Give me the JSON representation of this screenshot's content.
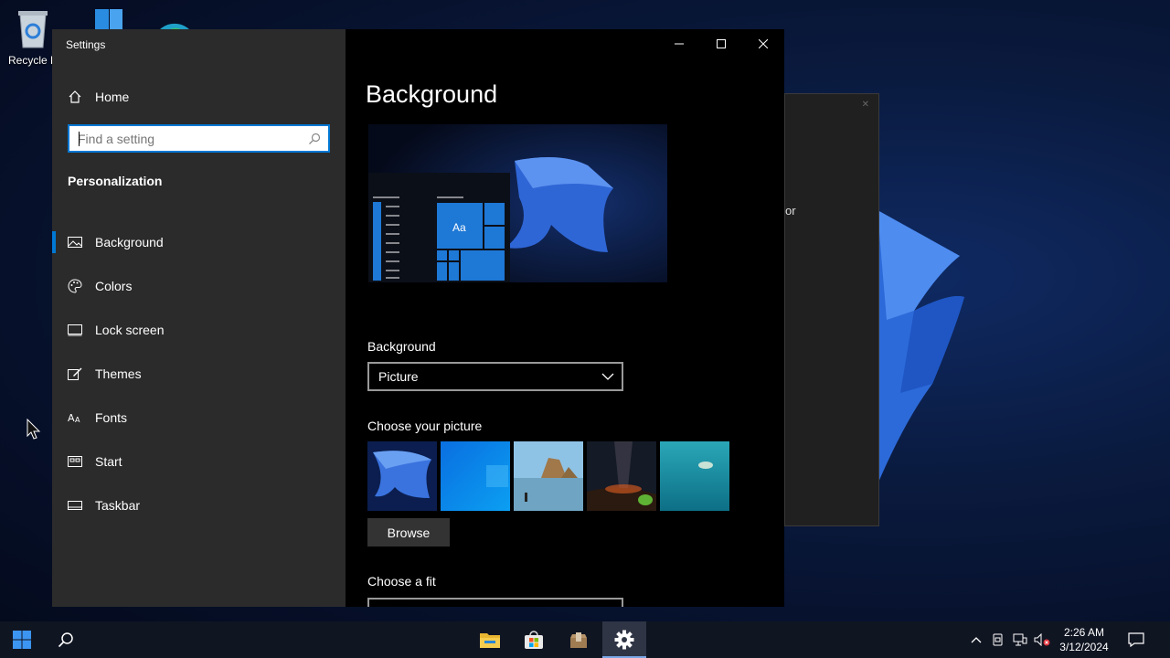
{
  "desktop": {
    "icons": [
      {
        "label": "Recycle B",
        "icon": "recycle-bin-icon"
      },
      {
        "label": "",
        "icon": "shortcut-icon"
      },
      {
        "label": "",
        "icon": "edge-icon"
      }
    ],
    "background_window_fragment": "or"
  },
  "window": {
    "title": "Settings",
    "controls": {
      "minimize": "minimize-icon",
      "maximize": "maximize-icon",
      "close": "close-icon"
    }
  },
  "sidebar": {
    "home_label": "Home",
    "search_placeholder": "Find a setting",
    "section_title": "Personalization",
    "items": [
      {
        "label": "Background",
        "icon": "picture-icon",
        "active": true
      },
      {
        "label": "Colors",
        "icon": "palette-icon",
        "active": false
      },
      {
        "label": "Lock screen",
        "icon": "lock-screen-icon",
        "active": false
      },
      {
        "label": "Themes",
        "icon": "themes-icon",
        "active": false
      },
      {
        "label": "Fonts",
        "icon": "fonts-icon",
        "active": false
      },
      {
        "label": "Start",
        "icon": "start-icon",
        "active": false
      },
      {
        "label": "Taskbar",
        "icon": "taskbar-icon",
        "active": false
      }
    ]
  },
  "main": {
    "page_title": "Background",
    "preview": {
      "tile_text": "Aa"
    },
    "background_label": "Background",
    "background_value": "Picture",
    "choose_picture_label": "Choose your picture",
    "pictures": [
      "bloom-wallpaper",
      "windows-blue-wallpaper",
      "beach-rocks-wallpaper",
      "night-sky-wallpaper",
      "underwater-wallpaper"
    ],
    "browse_label": "Browse",
    "choose_fit_label": "Choose a fit"
  },
  "taskbar": {
    "start": "windows-start-icon",
    "search": "search-icon",
    "apps": [
      "file-explorer-icon",
      "store-icon",
      "package-icon",
      "settings-gear-icon"
    ],
    "tray": [
      "chevron-up-icon",
      "device-icon",
      "network-icon",
      "volume-muted-icon",
      "notification-icon"
    ],
    "time": "2:26 AM",
    "date": "3/12/2024"
  },
  "colors": {
    "accent": "#0078d4",
    "sidebar_bg": "#2b2b2b",
    "content_bg": "#000000",
    "taskbar_bg": "#101522"
  }
}
